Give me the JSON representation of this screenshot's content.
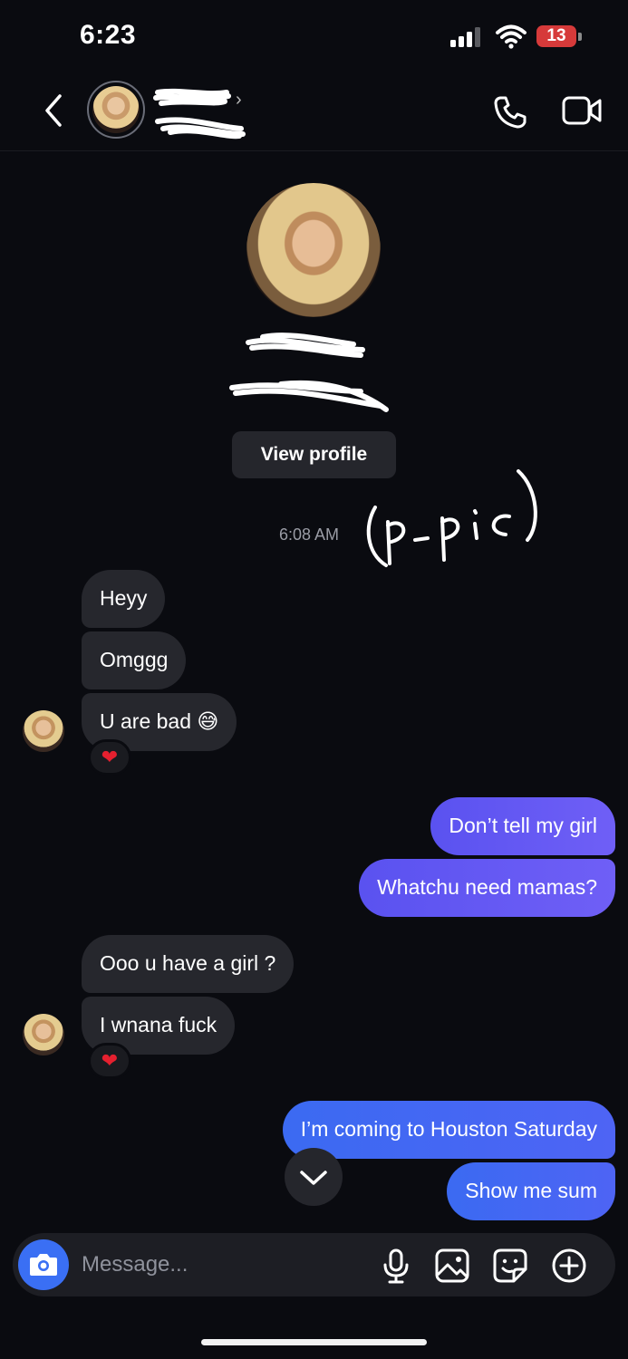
{
  "status_bar": {
    "time": "6:23",
    "battery": "13"
  },
  "header": {
    "back_icon": "chevron-left-icon",
    "call_icon": "phone-icon",
    "video_icon": "video-camera-icon"
  },
  "profile": {
    "view_profile_label": "View profile"
  },
  "thread": {
    "timestamp": "6:08 AM",
    "annotation": "(p-pic)",
    "messages": [
      {
        "from": "them",
        "text": "Heyy"
      },
      {
        "from": "them",
        "text": "Omggg"
      },
      {
        "from": "them",
        "text": "U are bad 😅",
        "reaction": "❤"
      },
      {
        "from": "me",
        "text": "Don’t tell my girl"
      },
      {
        "from": "me",
        "text": "Whatchu need mamas?"
      },
      {
        "from": "them",
        "text": "Ooo u have a girl ?"
      },
      {
        "from": "them",
        "text": "I wnana fuck",
        "reaction": "❤"
      },
      {
        "from": "me",
        "text": "I’m coming to Houston Saturday"
      },
      {
        "from": "me",
        "text": "Show me sum"
      }
    ]
  },
  "composer": {
    "placeholder": "Message..."
  },
  "colors": {
    "background": "#0a0b10",
    "incoming": "#26272d",
    "outgoing": "#5a52f0",
    "accent": "#3a6ff4",
    "reaction": "#e5202f"
  }
}
